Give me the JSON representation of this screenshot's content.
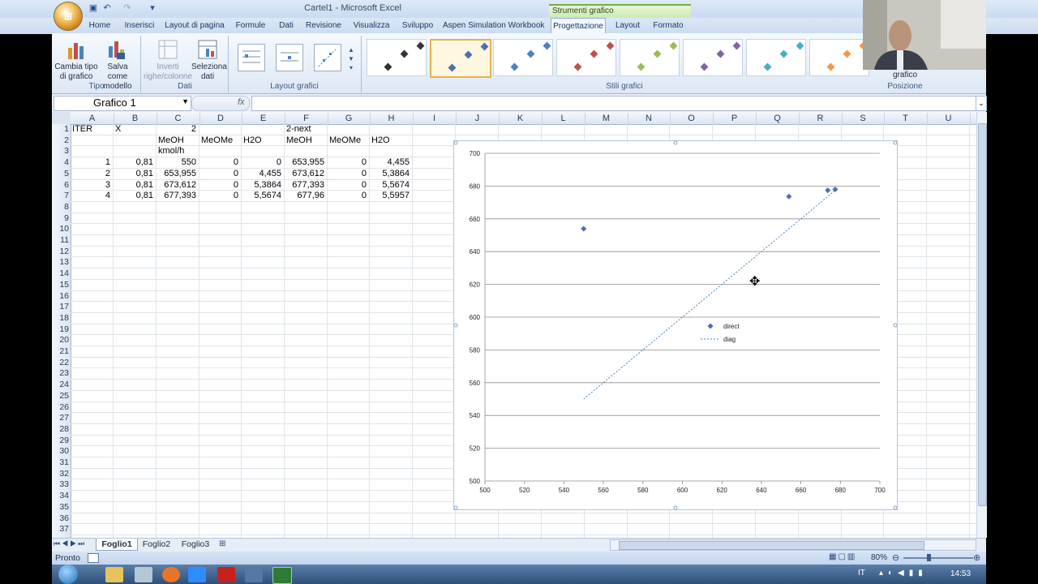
{
  "window": {
    "title": "Cartel1 - Microsoft Excel",
    "context_band": "Strumenti grafico"
  },
  "tabs": [
    "Home",
    "Inserisci",
    "Layout di pagina",
    "Formule",
    "Dati",
    "Revisione",
    "Visualizza",
    "Sviluppo",
    "Aspen Simulation Workbook",
    "Progettazione",
    "Layout",
    "Formato"
  ],
  "active_tab": "Progettazione",
  "ribbon": {
    "tipo": {
      "label": "Tipo",
      "change_type": "Cambia tipo di grafico",
      "save_template": "Salva come modello"
    },
    "dati": {
      "label": "Dati",
      "switch": "Inverti righe/colonne",
      "select": "Seleziona dati"
    },
    "layout_label": "Layout grafici",
    "stili_label": "Stili grafici",
    "posizione": {
      "label": "Posizione",
      "move": "grafico"
    },
    "style_colors": [
      "#333333",
      "#4f6fae",
      "#4f81bd",
      "#c0504d",
      "#9bbb59",
      "#8064a2",
      "#4bacc6",
      "#f79646"
    ]
  },
  "formula_bar": {
    "name_box": "Grafico 1",
    "fx": "fx"
  },
  "columns": [
    "A",
    "B",
    "C",
    "D",
    "E",
    "F",
    "G",
    "H",
    "I",
    "J",
    "K",
    "L",
    "M",
    "N",
    "O",
    "P",
    "Q",
    "R",
    "S",
    "T",
    "U"
  ],
  "rows": [
    "1",
    "2",
    "3",
    "4",
    "5",
    "6",
    "7",
    "8",
    "9",
    "10",
    "11",
    "12",
    "13",
    "14",
    "15",
    "16",
    "17",
    "18",
    "19",
    "20",
    "21",
    "22",
    "23",
    "24",
    "25",
    "26",
    "27",
    "28",
    "29",
    "30",
    "31",
    "32",
    "33",
    "34",
    "35",
    "36",
    "37"
  ],
  "cells": {
    "A1": "ITER",
    "B1": "X",
    "C1": "2",
    "F1": "2-next",
    "C2": "MeOH",
    "D2": "MeOMe",
    "E2": "H2O",
    "F2": "MeOH",
    "G2": "MeOMe",
    "H2": "H2O",
    "C3": "kmol/h",
    "A4": "1",
    "B4": "0,81",
    "C4": "550",
    "D4": "0",
    "E4": "0",
    "F4": "653,955",
    "G4": "0",
    "H4": "4,455",
    "A5": "2",
    "B5": "0,81",
    "C5": "653,955",
    "D5": "0",
    "E5": "4,455",
    "F5": "673,612",
    "G5": "0",
    "H5": "5,3864",
    "A6": "3",
    "B6": "0,81",
    "C6": "673,612",
    "D6": "0",
    "E6": "5,3864",
    "F6": "677,393",
    "G6": "0",
    "H6": "5,5674",
    "A7": "4",
    "B7": "0,81",
    "C7": "677,393",
    "D7": "0",
    "E7": "5,5674",
    "F7": "677,96",
    "G7": "0",
    "H7": "5,5957"
  },
  "chart_data": {
    "type": "scatter",
    "xlim": [
      500,
      700
    ],
    "ylim": [
      500,
      700
    ],
    "xticks": [
      "500",
      "520",
      "540",
      "560",
      "580",
      "600",
      "620",
      "640",
      "660",
      "680",
      "700"
    ],
    "yticks": [
      "500",
      "520",
      "540",
      "560",
      "580",
      "600",
      "620",
      "640",
      "660",
      "680",
      "700"
    ],
    "grid": "horizontal",
    "legend_position": "center",
    "series": [
      {
        "name": "direct",
        "style": "markers",
        "color": "#4f6fae",
        "x": [
          550,
          653.955,
          673.612,
          677.393
        ],
        "y": [
          653.955,
          673.612,
          677.393,
          677.96
        ]
      },
      {
        "name": "diag",
        "style": "dashed-line",
        "color": "#4f81bd",
        "x": [
          550,
          677.96
        ],
        "y": [
          550,
          677.96
        ]
      }
    ]
  },
  "sheets": [
    "Foglio1",
    "Foglio2",
    "Foglio3"
  ],
  "status": {
    "ready": "Pronto",
    "zoom": "80%"
  },
  "taskbar": {
    "lang": "IT",
    "time": "14:53"
  }
}
